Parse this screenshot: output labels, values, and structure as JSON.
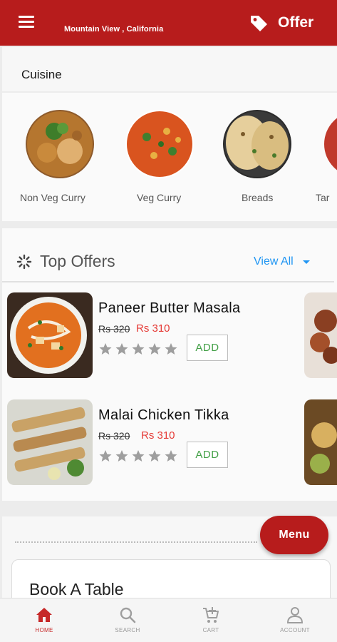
{
  "header": {
    "location": "Mountain View , California",
    "offer_label": "Offer"
  },
  "cuisine": {
    "title": "Cuisine",
    "items": [
      {
        "label": "Non Veg Curry"
      },
      {
        "label": "Veg Curry"
      },
      {
        "label": "Breads"
      },
      {
        "label": "Tar"
      }
    ]
  },
  "top_offers": {
    "title": "Top Offers",
    "view_all": "View All",
    "items": [
      {
        "name": "Paneer Butter Masala",
        "old_price": "Rs 320",
        "new_price": "Rs 310",
        "rating": 0,
        "add_label": "ADD"
      },
      {
        "name": "Malai Chicken Tikka",
        "old_price": "Rs 320",
        "new_price": "Rs 310",
        "rating": 0,
        "add_label": "ADD"
      }
    ]
  },
  "book_table": {
    "title": "Book A Table"
  },
  "fab": {
    "label": "Menu"
  },
  "bottom_nav": {
    "items": [
      {
        "label": "HOME",
        "icon": "home-icon",
        "active": true
      },
      {
        "label": "SEARCH",
        "icon": "search-icon",
        "active": false
      },
      {
        "label": "CART",
        "icon": "cart-icon",
        "active": false
      },
      {
        "label": "ACCOUNT",
        "icon": "account-icon",
        "active": false
      }
    ]
  },
  "colors": {
    "brand_red": "#b71c1c",
    "price_red": "#e53935",
    "link_blue": "#2196f3",
    "add_green": "#43a047"
  }
}
